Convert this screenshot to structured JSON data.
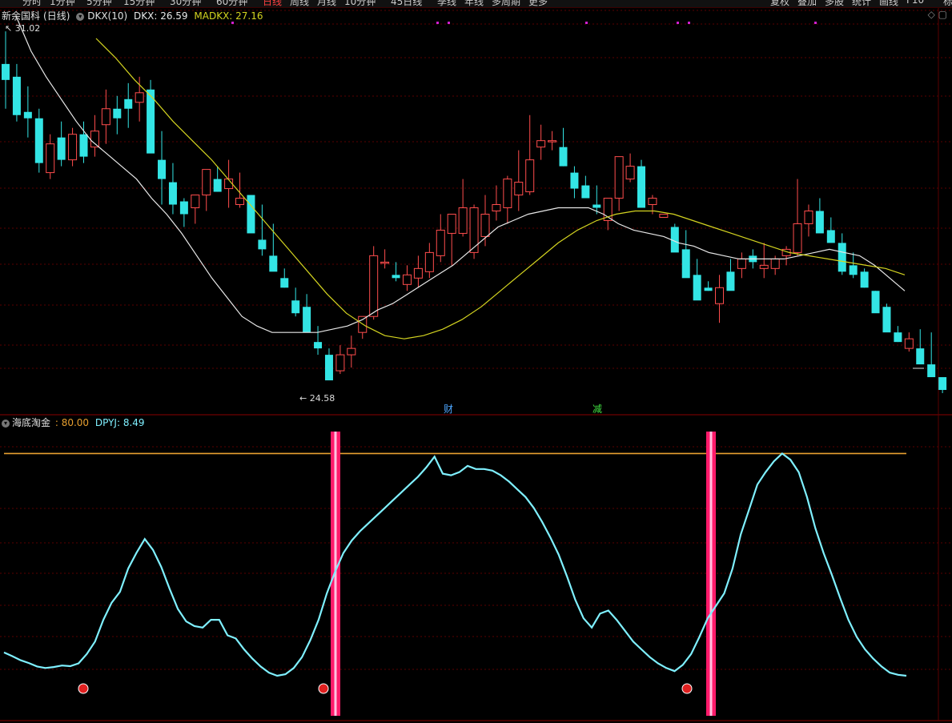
{
  "toolbar": {
    "tabs": [
      "分时",
      "1分钟",
      "5分钟",
      "15分钟",
      "30分钟",
      "60分钟",
      "日线",
      "周线",
      "月线",
      "10分钟",
      "45日线",
      "季线",
      "年线",
      "多周期",
      "更多"
    ],
    "active_tab": "日线",
    "right_tabs": [
      "复权",
      "叠加",
      "多股",
      "统计",
      "画线",
      "F10",
      "标记"
    ]
  },
  "main": {
    "stock_name": "新余国科",
    "period": "(日线)",
    "indicator_name": "DKX(10)",
    "dkx_label": "DKX: 26.59",
    "madkx_label": "MADKX: 27.16",
    "high_label": "31.02",
    "low_label": "24.58",
    "event_markers": [
      "财",
      "减"
    ],
    "right_icons": "◇ ▢"
  },
  "sub": {
    "indicator_name": "海底淘金",
    "line1_label": ": 80.00",
    "line2_label": "DPYJ: 8.49"
  },
  "colors": {
    "up": "#ff4d4d",
    "down": "#33e5e5",
    "dkx": "#e8e8e8",
    "madkx": "#d4d420",
    "threshold": "#e8a030",
    "dpyj": "#7ff0ff",
    "signal": "#ff1a6a",
    "grid": "#5a0000"
  },
  "chart_data": {
    "type": "candlestick",
    "candles": [
      [
        30.0,
        31.02,
        28.6,
        29.5
      ],
      [
        29.6,
        30.0,
        28.2,
        28.4
      ],
      [
        28.5,
        29.3,
        27.7,
        28.3
      ],
      [
        28.3,
        28.6,
        26.6,
        26.9
      ],
      [
        26.6,
        27.8,
        26.4,
        27.5
      ],
      [
        27.7,
        28.2,
        26.8,
        27.0
      ],
      [
        27.0,
        28.0,
        26.8,
        27.8
      ],
      [
        27.8,
        28.2,
        26.9,
        27.1
      ],
      [
        27.4,
        28.4,
        27.1,
        27.9
      ],
      [
        28.1,
        29.2,
        27.5,
        28.6
      ],
      [
        28.6,
        29.0,
        27.8,
        28.3
      ],
      [
        28.9,
        29.4,
        28.0,
        28.6
      ],
      [
        28.8,
        29.6,
        28.2,
        29.1
      ],
      [
        29.2,
        29.5,
        27.9,
        27.2
      ],
      [
        27.0,
        27.9,
        25.6,
        26.4
      ],
      [
        26.3,
        26.9,
        25.3,
        25.6
      ],
      [
        25.7,
        25.8,
        24.9,
        25.3
      ],
      [
        25.5,
        25.9,
        25.0,
        25.9
      ],
      [
        25.9,
        26.3,
        25.4,
        26.7
      ],
      [
        26.4,
        26.8,
        26.0,
        26.0
      ],
      [
        26.1,
        27.0,
        25.5,
        26.4
      ],
      [
        25.6,
        26.6,
        25.5,
        25.8
      ],
      [
        25.9,
        25.9,
        24.9,
        24.7
      ],
      [
        24.5,
        25.6,
        24.0,
        24.2
      ],
      [
        24.0,
        25.0,
        23.6,
        23.5
      ],
      [
        23.3,
        23.6,
        23.0,
        23.0
      ],
      [
        22.6,
        23.0,
        22.1,
        22.2
      ],
      [
        22.4,
        22.8,
        21.7,
        21.6
      ],
      [
        21.3,
        21.8,
        20.9,
        21.1
      ],
      [
        20.9,
        21.1,
        20.5,
        20.1
      ],
      [
        20.4,
        21.2,
        20.3,
        20.9
      ],
      [
        20.9,
        21.5,
        20.5,
        21.1
      ],
      [
        21.6,
        22.0,
        21.4,
        22.1
      ],
      [
        22.1,
        24.3,
        22.0,
        24.0
      ],
      [
        23.8,
        24.2,
        23.6,
        23.8
      ],
      [
        23.4,
        23.8,
        23.2,
        23.3
      ],
      [
        23.1,
        23.7,
        22.9,
        23.4
      ],
      [
        23.3,
        24.0,
        23.0,
        23.6
      ],
      [
        23.5,
        24.4,
        23.3,
        24.1
      ],
      [
        24.0,
        25.3,
        23.8,
        24.8
      ],
      [
        24.7,
        25.1,
        23.7,
        25.3
      ],
      [
        24.7,
        26.4,
        24.6,
        25.5
      ],
      [
        24.1,
        25.6,
        23.9,
        25.5
      ],
      [
        24.6,
        25.9,
        24.3,
        25.3
      ],
      [
        25.4,
        26.2,
        25.1,
        25.6
      ],
      [
        25.5,
        26.5,
        25.0,
        26.4
      ],
      [
        25.9,
        27.3,
        25.4,
        26.3
      ],
      [
        26.0,
        28.4,
        25.9,
        27.0
      ],
      [
        27.4,
        28.1,
        27.0,
        27.6
      ],
      [
        27.6,
        27.9,
        27.3,
        27.6
      ],
      [
        27.4,
        28.0,
        26.8,
        26.8
      ],
      [
        26.6,
        26.8,
        25.8,
        26.1
      ],
      [
        26.2,
        26.5,
        25.9,
        25.8
      ],
      [
        25.6,
        26.2,
        25.3,
        25.5
      ],
      [
        25.1,
        25.6,
        24.8,
        25.8
      ],
      [
        25.8,
        26.8,
        25.4,
        27.1
      ],
      [
        26.4,
        27.2,
        26.3,
        26.8
      ],
      [
        26.8,
        27.0,
        25.7,
        25.5
      ],
      [
        25.6,
        25.9,
        25.3,
        25.8
      ],
      [
        25.2,
        25.3,
        25.2,
        25.3
      ],
      [
        24.9,
        25.0,
        24.5,
        24.1
      ],
      [
        24.2,
        24.8,
        23.6,
        23.3
      ],
      [
        23.4,
        23.9,
        23.2,
        22.6
      ],
      [
        23.0,
        23.2,
        22.9,
        22.9
      ],
      [
        22.5,
        23.4,
        21.9,
        23.0
      ],
      [
        23.5,
        23.9,
        23.0,
        22.9
      ],
      [
        23.6,
        24.1,
        23.3,
        23.9
      ],
      [
        24.0,
        24.2,
        23.6,
        23.8
      ],
      [
        23.6,
        24.4,
        23.3,
        23.7
      ],
      [
        23.6,
        24.0,
        23.4,
        23.9
      ],
      [
        24.0,
        24.3,
        23.7,
        24.2
      ],
      [
        24.1,
        26.4,
        24.0,
        25.0
      ],
      [
        25.0,
        25.6,
        24.6,
        25.4
      ],
      [
        25.4,
        25.8,
        24.8,
        24.7
      ],
      [
        24.8,
        25.2,
        24.5,
        24.4
      ],
      [
        24.4,
        24.7,
        23.4,
        23.5
      ],
      [
        23.7,
        24.1,
        23.3,
        23.4
      ],
      [
        23.5,
        23.6,
        23.0,
        23.0
      ],
      [
        22.9,
        22.9,
        22.3,
        22.2
      ],
      [
        22.4,
        22.5,
        21.8,
        21.6
      ],
      [
        21.6,
        21.8,
        21.3,
        21.3
      ],
      [
        21.1,
        21.6,
        21.0,
        21.4
      ],
      [
        21.1,
        21.7,
        20.7,
        20.6
      ],
      [
        20.6,
        21.6,
        20.4,
        20.2
      ],
      [
        20.2,
        20.1,
        19.7,
        19.8
      ]
    ],
    "dkx": [
      31.5,
      30.4,
      29.6,
      28.9,
      28.2,
      27.6,
      27.2,
      26.8,
      26.4,
      25.8,
      25.3,
      24.7,
      24.0,
      23.3,
      22.7,
      22.1,
      21.8,
      21.6,
      21.6,
      21.6,
      21.6,
      21.7,
      21.8,
      22.0,
      22.3,
      22.5,
      22.8,
      23.1,
      23.4,
      23.7,
      24.1,
      24.5,
      24.9,
      25.1,
      25.3,
      25.4,
      25.5,
      25.5,
      25.5,
      25.3,
      25.0,
      24.8,
      24.7,
      24.6,
      24.4,
      24.3,
      24.1,
      24.0,
      23.9,
      23.9,
      23.9,
      23.9,
      24.0,
      24.1,
      24.2,
      24.1,
      24.0,
      23.7,
      23.3,
      22.9
    ],
    "madkx": [
      30.8,
      30.2,
      29.5,
      28.9,
      28.2,
      27.6,
      27.0,
      26.3,
      25.6,
      24.9,
      24.2,
      23.5,
      22.8,
      22.2,
      21.8,
      21.5,
      21.4,
      21.5,
      21.7,
      22.0,
      22.4,
      22.9,
      23.4,
      23.9,
      24.4,
      24.8,
      25.1,
      25.3,
      25.4,
      25.4,
      25.3,
      25.1,
      24.9,
      24.7,
      24.5,
      24.3,
      24.1,
      24.0,
      23.9,
      23.8,
      23.7,
      23.6,
      23.4
    ],
    "dpyj": [
      16,
      14.8,
      13.5,
      12.6,
      11.5,
      11.0,
      11.3,
      11.8,
      11.6,
      12.5,
      15.5,
      19.5,
      26.5,
      32.0,
      35.5,
      43.0,
      48.0,
      52.5,
      49.0,
      43.5,
      36.5,
      30.0,
      26.0,
      24.5,
      24.0,
      26.5,
      26.5,
      21.5,
      20.5,
      17.0,
      14.0,
      11.5,
      9.5,
      8.5,
      9.0,
      11.0,
      14.5,
      20.0,
      26.5,
      35.0,
      42.0,
      48.0,
      52.0,
      55.0,
      57.5,
      60.0,
      62.5,
      65.0,
      67.5,
      70.0,
      72.5,
      75.5,
      79.0,
      73.5,
      73.0,
      74.0,
      76.0,
      75.0,
      75.0,
      74.5,
      73.0,
      71.0,
      68.5,
      66.0,
      62.5,
      58.0,
      53.0,
      47.5,
      40.5,
      33.0,
      27.0,
      24.0,
      28.5,
      29.5,
      26.5,
      23.0,
      19.5,
      17.0,
      14.5,
      12.5,
      11.0,
      10.0,
      12.0,
      15.5,
      21.0,
      27.0,
      31.0,
      35.0,
      43.0,
      54.0,
      62.0,
      70.0,
      74.0,
      77.5,
      80.0,
      78.0,
      74.0,
      66.0,
      56.0,
      48.0,
      41.0,
      33.5,
      26.5,
      21.0,
      17.0,
      14.0,
      11.5,
      9.5,
      8.8,
      8.49
    ],
    "threshold": 80.0,
    "signals": [
      29,
      79
    ]
  }
}
